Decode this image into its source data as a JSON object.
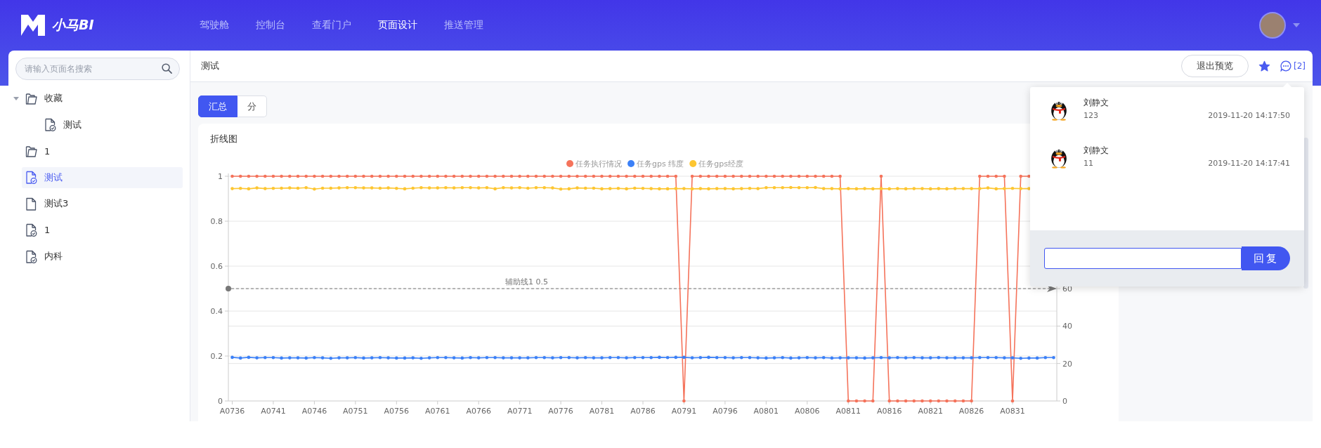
{
  "header": {
    "logo_text": "小马BI",
    "nav": [
      {
        "label": "驾驶舱",
        "selected": false
      },
      {
        "label": "控制台",
        "selected": false
      },
      {
        "label": "查看门户",
        "selected": false
      },
      {
        "label": "页面设计",
        "selected": true
      },
      {
        "label": "推送管理",
        "selected": false
      }
    ]
  },
  "sidebar": {
    "search": {
      "placeholder": "请输入页面名搜索"
    },
    "tree": [
      {
        "label": "收藏",
        "kind": "folder",
        "selected": false,
        "expanded": true,
        "children": [
          {
            "label": "测试",
            "kind": "page",
            "selected": false
          }
        ]
      },
      {
        "label": "1",
        "kind": "folder",
        "selected": false
      },
      {
        "label": "测试",
        "kind": "page",
        "selected": true
      },
      {
        "label": "测试3",
        "kind": "blank_page",
        "selected": false
      },
      {
        "label": "1",
        "kind": "page",
        "selected": false
      },
      {
        "label": "内科",
        "kind": "page",
        "selected": false
      }
    ]
  },
  "main_bar": {
    "breadcrumb": "测试",
    "exit_button": "退出预览",
    "starred": true,
    "comment_count": "[2]"
  },
  "tabs": [
    {
      "label": "汇总",
      "selected": true
    },
    {
      "label": "分",
      "selected": false
    }
  ],
  "card": {
    "title": "折线图",
    "chart_data": {
      "type": "line",
      "legend": "top",
      "grid": true,
      "categories": [
        "A0736",
        null,
        null,
        null,
        null,
        "A0741",
        null,
        null,
        null,
        null,
        "A0746",
        null,
        null,
        null,
        null,
        "A0751",
        null,
        null,
        null,
        null,
        "A0756",
        null,
        null,
        null,
        null,
        "A0761",
        null,
        null,
        null,
        null,
        "A0766",
        null,
        null,
        null,
        null,
        "A0771",
        null,
        null,
        null,
        null,
        "A0776",
        null,
        null,
        null,
        null,
        "A0781",
        null,
        null,
        null,
        null,
        "A0786",
        null,
        null,
        null,
        null,
        "A0791",
        null,
        null,
        null,
        null,
        "A0796",
        null,
        null,
        null,
        null,
        "A0801",
        null,
        null,
        null,
        null,
        "A0806",
        null,
        null,
        null,
        null,
        "A0811",
        null,
        null,
        null,
        null,
        "A0816",
        null,
        null,
        null,
        null,
        "A0821",
        null,
        null,
        null,
        null,
        "A0826",
        null,
        null,
        null,
        null,
        "A0831",
        null,
        null,
        null,
        null,
        null
      ],
      "series": [
        {
          "name": "任务执行情况",
          "color": "#f5735b",
          "values": [
            1,
            1,
            1,
            1,
            1,
            1,
            1,
            1,
            1,
            1,
            1,
            1,
            1,
            1,
            1,
            1,
            1,
            1,
            1,
            1,
            1,
            1,
            1,
            1,
            1,
            1,
            1,
            1,
            1,
            1,
            1,
            1,
            1,
            1,
            1,
            1,
            1,
            1,
            1,
            1,
            1,
            1,
            1,
            1,
            1,
            1,
            1,
            1,
            1,
            1,
            1,
            1,
            1,
            1,
            1,
            0,
            1,
            1,
            1,
            1,
            1,
            1,
            1,
            1,
            1,
            1,
            1,
            1,
            1,
            1,
            1,
            1,
            1,
            1,
            1,
            0,
            0,
            0,
            0,
            1,
            0,
            0,
            0,
            0,
            0,
            0,
            0,
            0,
            0,
            0,
            0,
            1,
            1,
            1,
            1,
            0,
            1,
            1,
            null,
            null,
            null
          ]
        },
        {
          "name": "任务gps 纬度",
          "color": "#3b80f7",
          "values": [
            0.194,
            0.191,
            0.194,
            0.192,
            0.193,
            0.193,
            0.191,
            0.192,
            0.192,
            0.191,
            0.193,
            0.192,
            0.19,
            0.192,
            0.192,
            0.193,
            0.191,
            0.192,
            0.193,
            0.192,
            0.191,
            0.191,
            0.192,
            0.19,
            0.192,
            0.193,
            0.193,
            0.192,
            0.191,
            0.193,
            0.192,
            0.193,
            0.193,
            0.192,
            0.192,
            0.192,
            0.192,
            0.193,
            0.193,
            0.192,
            0.193,
            0.193,
            0.192,
            0.193,
            0.192,
            0.192,
            0.193,
            0.193,
            0.192,
            0.193,
            0.193,
            0.193,
            0.194,
            0.193,
            0.194,
            0.194,
            0.192,
            0.193,
            0.194,
            0.193,
            0.193,
            0.192,
            0.193,
            0.193,
            0.192,
            0.191,
            0.192,
            0.193,
            0.191,
            0.192,
            0.193,
            0.192,
            0.193,
            0.191,
            0.192,
            0.192,
            0.192,
            0.191,
            0.192,
            0.193,
            0.192,
            0.193,
            0.192,
            0.193,
            0.192,
            0.192,
            0.193,
            0.192,
            0.192,
            0.192,
            0.192,
            0.193,
            0.193,
            0.193,
            0.192,
            0.192,
            0.19,
            0.191,
            0.191,
            0.193,
            0.193
          ]
        },
        {
          "name": "任务gps经度",
          "color": "#fdc631",
          "values": [
            0.945,
            0.946,
            0.944,
            0.948,
            0.945,
            0.946,
            0.947,
            0.948,
            0.947,
            0.949,
            0.943,
            0.947,
            0.947,
            0.948,
            0.949,
            0.949,
            0.948,
            0.948,
            0.947,
            0.948,
            0.946,
            0.944,
            0.947,
            0.949,
            0.948,
            0.948,
            0.949,
            0.948,
            0.949,
            0.949,
            0.948,
            0.949,
            0.944,
            0.949,
            0.948,
            0.949,
            0.947,
            0.949,
            0.949,
            0.948,
            0.943,
            0.944,
            0.948,
            0.947,
            0.947,
            0.944,
            0.945,
            0.946,
            0.944,
            0.947,
            0.946,
            0.945,
            0.944,
            0.944,
            0.945,
            0.945,
            0.944,
            0.945,
            0.944,
            0.945,
            0.945,
            0.944,
            0.945,
            0.946,
            0.945,
            0.949,
            0.949,
            0.949,
            0.95,
            0.949,
            0.949,
            0.95,
            0.945,
            0.945,
            0.944,
            0.945,
            0.944,
            0.945,
            0.944,
            0.945,
            0.944,
            0.945,
            0.944,
            0.945,
            0.945,
            0.944,
            0.945,
            0.944,
            0.945,
            0.945,
            0.945,
            0.945,
            0.948,
            0.944,
            0.945,
            0.946,
            0.945,
            0.945,
            null,
            null,
            null
          ]
        }
      ],
      "ylim": [
        0,
        1
      ],
      "yticks": [
        0,
        0.2,
        0.4,
        0.6,
        0.8,
        1
      ],
      "y2lim": [
        0,
        120
      ],
      "y2ticks": [
        0,
        20,
        40,
        60
      ],
      "ref_lines": [
        {
          "axis": "y",
          "value": 0.5,
          "label": "辅助线1 0.5"
        }
      ]
    }
  },
  "comments_popup": {
    "comments": [
      {
        "author": "刘静文",
        "text": "123",
        "time": "2019-11-20 14:17:50"
      },
      {
        "author": "刘静文",
        "text": "11",
        "time": "2019-11-20 14:17:41"
      }
    ],
    "reply_button": "回复"
  }
}
